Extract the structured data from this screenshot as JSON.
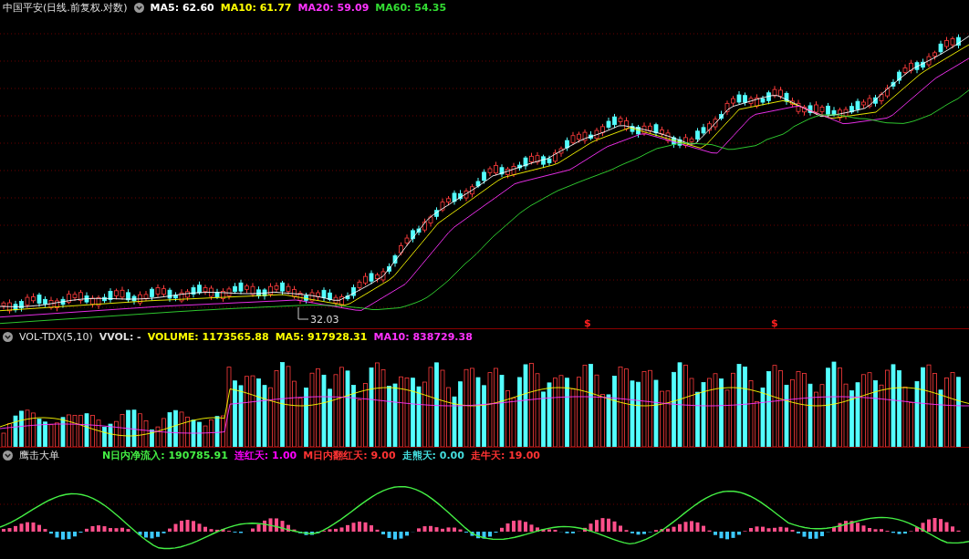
{
  "price_panel": {
    "title": "中国平安(日线.前复权.对数)",
    "indicators": [
      {
        "label": "MA5: 62.60",
        "color": "#ffffff"
      },
      {
        "label": "MA10: 61.77",
        "color": "#ffff00"
      },
      {
        "label": "MA20: 59.09",
        "color": "#ff33ff"
      },
      {
        "label": "MA60: 54.35",
        "color": "#33dd33"
      }
    ],
    "low_label": "32.03",
    "markers": [
      "$",
      "$"
    ]
  },
  "volume_panel": {
    "title": "VOL-TDX(5,10)",
    "indicators": [
      {
        "label": "VVOL: -",
        "color": "#dddddd"
      },
      {
        "label": "VOLUME: 1173565.88",
        "color": "#ffff00"
      },
      {
        "label": "MA5: 917928.31",
        "color": "#ffff00"
      },
      {
        "label": "MA10: 838729.38",
        "color": "#ff33ff"
      }
    ]
  },
  "flow_panel": {
    "title": "鹰击大单",
    "indicators": [
      {
        "label": "N日内净流入: 190785.91",
        "color": "#44ee44"
      },
      {
        "label": "连红天: 1.00",
        "color": "#ff00ff"
      },
      {
        "label": "M日内翻红天: 9.00",
        "color": "#ff3333"
      },
      {
        "label": "走熊天: 0.00",
        "color": "#44dddd"
      },
      {
        "label": "走牛天: 19.00",
        "color": "#ff3333"
      }
    ]
  }
}
